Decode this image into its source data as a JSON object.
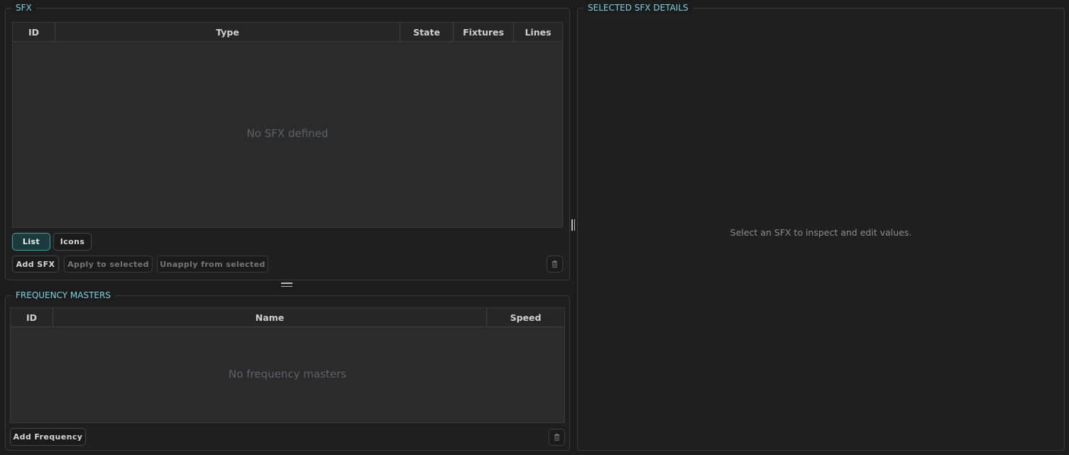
{
  "sfx_panel": {
    "title": "SFX",
    "columns": [
      "ID",
      "Type",
      "State",
      "Fixtures",
      "Lines"
    ],
    "empty_message": "No SFX defined",
    "view_toggle": {
      "list_label": "List",
      "icons_label": "Icons",
      "active": "List"
    },
    "actions": {
      "add_label": "Add SFX",
      "apply_label": "Apply to selected",
      "unapply_label": "Unapply from selected"
    }
  },
  "frequency_panel": {
    "title": "FREQUENCY MASTERS",
    "columns": [
      "ID",
      "Name",
      "Speed"
    ],
    "empty_message": "No frequency masters",
    "actions": {
      "add_label": "Add Frequency"
    }
  },
  "details_panel": {
    "title": "SELECTED SFX DETAILS",
    "placeholder": "Select an SFX to inspect and edit values."
  },
  "icons": {
    "delete": "trash-icon",
    "splitter_vertical": "vertical-splitter-handle",
    "splitter_horizontal": "horizontal-splitter-handle"
  },
  "colors": {
    "accent": "#7ecfe0",
    "active_button": "#3aa6a8",
    "background": "#1c1c1c",
    "table_body": "#2b2b2b"
  }
}
